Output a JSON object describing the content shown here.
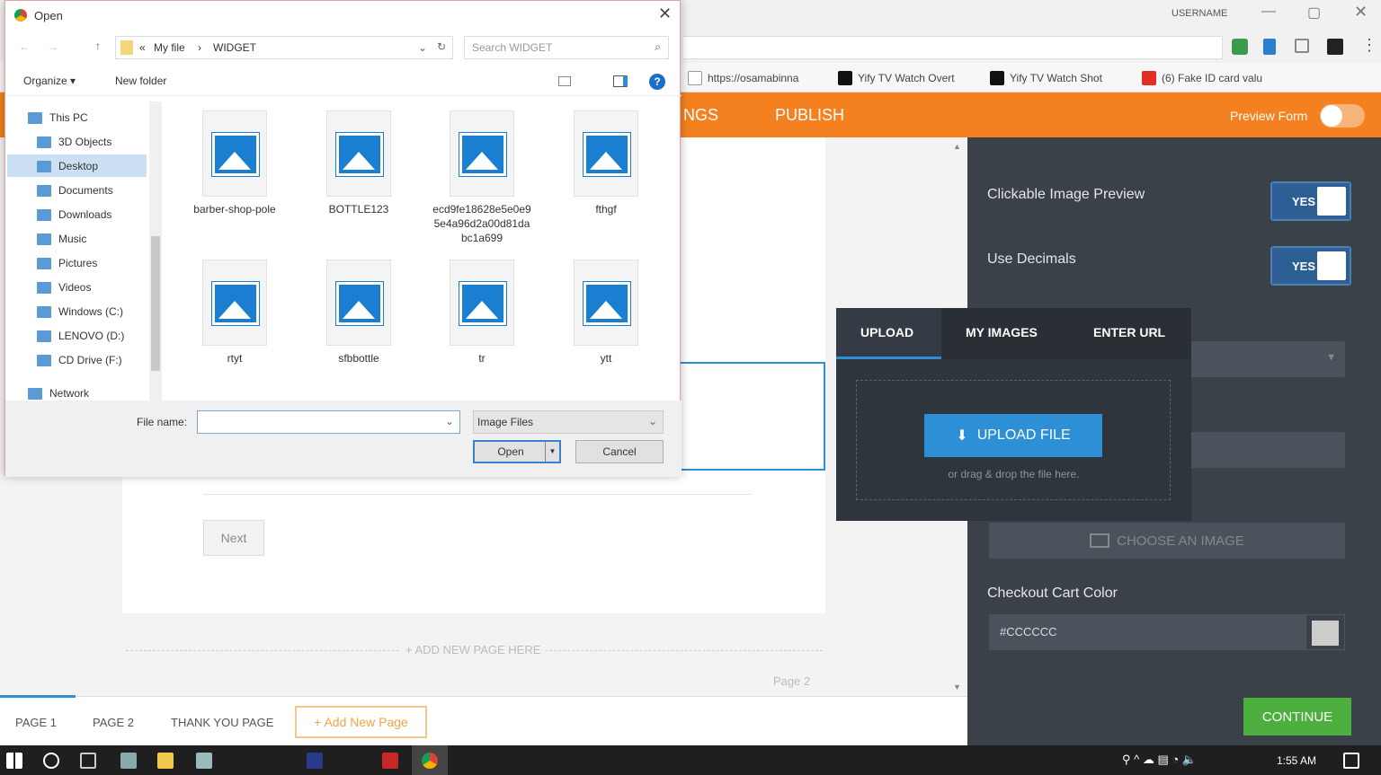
{
  "browser": {
    "profile": "USERNAME",
    "bookmarks": [
      "https://osamabinna",
      "Yify TV Watch Overt",
      "Yify TV Watch Shot",
      "(6) Fake ID card valu"
    ]
  },
  "builder": {
    "nav": [
      "NGS",
      "PUBLISH"
    ],
    "preview_label": "Preview Form",
    "next": "Next",
    "add_page_here": "+ ADD NEW PAGE HERE",
    "page_indicator": "Page 2",
    "tabs": [
      "PAGE 1",
      "PAGE 2",
      "THANK YOU PAGE"
    ],
    "add_new_page": "+ Add New Page"
  },
  "panel": {
    "clickable_preview": "Clickable Image Preview",
    "use_decimals": "Use Decimals",
    "yes": "YES",
    "choose_image": "CHOOSE AN IMAGE",
    "cart_color_label": "Checkout Cart Color",
    "cart_color_value": "#CCCCCC",
    "continue": "CONTINUE"
  },
  "upload": {
    "tabs": [
      "UPLOAD",
      "MY IMAGES",
      "ENTER URL"
    ],
    "button": "UPLOAD FILE",
    "hint": "or drag & drop the file here."
  },
  "dialog": {
    "title": "Open",
    "breadcrumb": [
      "«",
      "My file",
      "›",
      "WIDGET"
    ],
    "search_placeholder": "Search WIDGET",
    "organize": "Organize ▾",
    "new_folder": "New folder",
    "nav": [
      "This PC",
      "3D Objects",
      "Desktop",
      "Documents",
      "Downloads",
      "Music",
      "Pictures",
      "Videos",
      "Windows (C:)",
      "LENOVO (D:)",
      "CD Drive (F:)",
      "Network"
    ],
    "files": [
      "barber-shop-pole",
      "BOTTLE123",
      "ecd9fe18628e5e0e95e4a96d2a00d81dabc1a699",
      "fthgf",
      "rtyt",
      "sfbbottle",
      "tr",
      "ytt"
    ],
    "file_name_label": "File name:",
    "file_name_value": "",
    "filter": "Image Files",
    "open": "Open",
    "cancel": "Cancel"
  },
  "taskbar": {
    "time": "1:55 AM"
  },
  "colors": {
    "orange": "#f5801f",
    "panel": "#3a4149",
    "blue": "#2d8fd5",
    "green": "#4caf3e"
  }
}
